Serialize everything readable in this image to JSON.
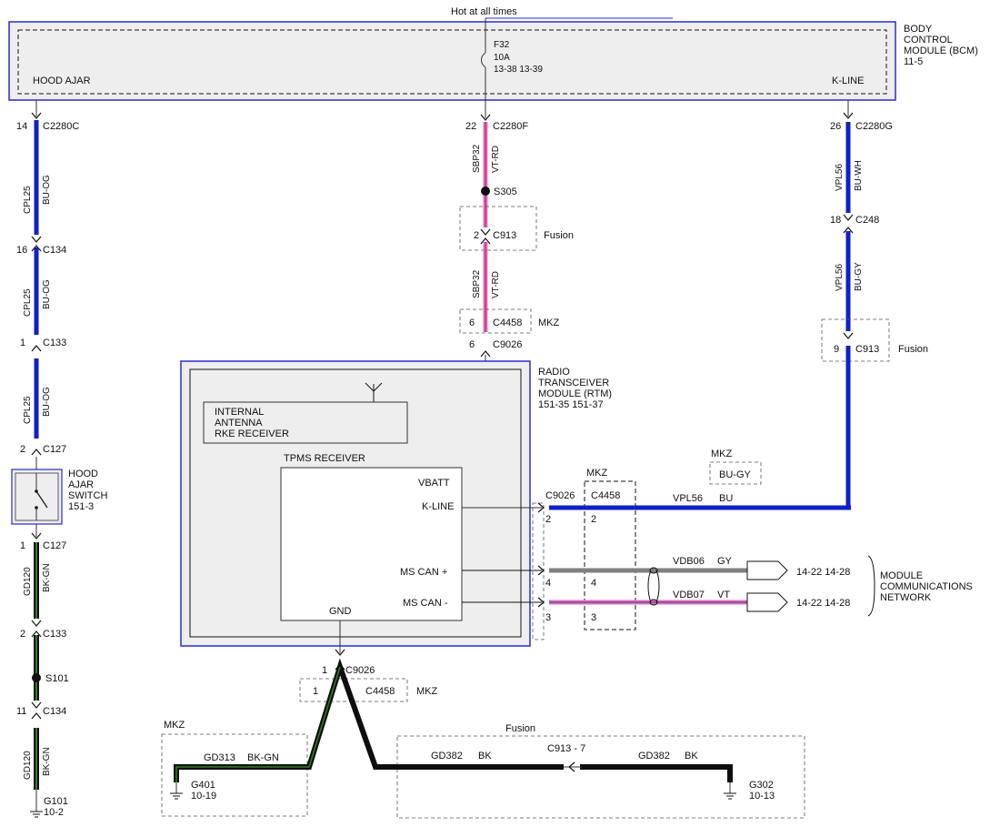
{
  "top_label": "Hot at all times",
  "bcm": {
    "name_lines": [
      "BODY",
      "CONTROL",
      "MODULE (BCM)",
      "11-5"
    ],
    "pin_left": "HOOD AJAR",
    "pin_right": "K-LINE",
    "fuse": [
      "F32",
      "10A",
      "13-38  13-39"
    ]
  },
  "rtm": {
    "name_lines": [
      "RADIO",
      "TRANSCEIVER",
      "MODULE (RTM)",
      "151-35  151-37"
    ],
    "antenna_box": [
      "INTERNAL",
      "ANTENNA",
      "RKE RECEIVER"
    ],
    "tpms_title": "TPMS RECEIVER",
    "pins": {
      "vbatt": "VBATT",
      "kline": "K-LINE",
      "mscan_plus": "MS CAN +",
      "mscan_minus": "MS CAN -",
      "gnd": "GND"
    }
  },
  "switch": {
    "lines": [
      "HOOD",
      "AJAR",
      "SWITCH",
      "151-3"
    ]
  },
  "left_circuit": {
    "c2280c_pin": "14",
    "c2280c": "C2280C",
    "w1_circuit": "CPL25",
    "w1_color": "BU-OG",
    "c134a_pin": "16",
    "c134a": "C134",
    "w2_circuit": "CPL25",
    "w2_color": "BU-OG",
    "c133a_pin": "1",
    "c133a": "C133",
    "w3_circuit": "CPL25",
    "w3_color": "BU-OG",
    "c127a_pin": "2",
    "c127a": "C127",
    "c127b_pin": "1",
    "c127b": "C127",
    "w4_circuit": "GD120",
    "w4_color": "BK-GN",
    "c133b_pin": "2",
    "c133b": "C133",
    "s101": "S101",
    "c134b_pin": "11",
    "c134b": "C134",
    "w5_circuit": "GD120",
    "w5_color": "BK-GN",
    "g101": "G101",
    "g101_ref": "10-2"
  },
  "mid_circuit": {
    "c2280f_pin": "22",
    "c2280f": "C2280F",
    "w1_circuit": "SBP32",
    "w1_color": "VT-RD",
    "s305": "S305",
    "c913_pin": "2",
    "c913": "C913",
    "c913_note": "Fusion",
    "w2_circuit": "SBP32",
    "w2_color": "VT-RD",
    "c4458_pin": "6",
    "c4458": "C4458",
    "c4458_note": "MKZ",
    "c9026_pin": "6",
    "c9026": "C9026"
  },
  "right_circuit": {
    "c2280g_pin": "26",
    "c2280g": "C2280G",
    "w1_circuit": "VPL56",
    "w1_color": "BU-WH",
    "c248_pin": "18",
    "c248": "C248",
    "w2_circuit": "VPL56",
    "w2_color": "BU-GY",
    "c913_pin": "9",
    "c913": "C913",
    "c913_note": "Fusion"
  },
  "network": {
    "mkz_label": "MKZ",
    "mkz_color": "BU-GY",
    "c9026": "C9026",
    "c4458": "C4458",
    "c4458_note": "MKZ",
    "kline_pin": "2",
    "kline_pin2": "2",
    "kline_circuit": "VPL56",
    "kline_color": "BU",
    "canp_pin": "4",
    "canp_pin2": "4",
    "canp_circuit": "VDB06",
    "canp_color": "GY",
    "canm_pin": "3",
    "canm_pin2": "3",
    "canm_circuit": "VDB07",
    "canm_color": "VT",
    "canp_ref": "14-22  14-28",
    "canm_ref": "14-22  14-28",
    "mcn_lines": [
      "MODULE",
      "COMMUNICATIONS",
      "NETWORK"
    ]
  },
  "ground": {
    "c9026_pin": "1",
    "c9026": "C9026",
    "c4458_pin": "1",
    "c4458": "C4458",
    "c4458_note": "MKZ",
    "mkz_label": "MKZ",
    "fusion_label": "Fusion",
    "gd313": "GD313",
    "gd313_color": "BK-GN",
    "g401": "G401",
    "g401_ref": "10-19",
    "gd382a": "GD382",
    "gd382a_color": "BK",
    "c913_7": "C913 - 7",
    "gd382b": "GD382",
    "gd382b_color": "BK",
    "g302": "G302",
    "g302_ref": "10-13"
  },
  "colors": {
    "blue_wire": "#1020c8",
    "pink_wire": "#e070d0",
    "gray_wire": "#808080",
    "green_stripe": "#2e7d1e",
    "module_border": "#2b2bd0",
    "module_fill": "#eeeeee"
  }
}
